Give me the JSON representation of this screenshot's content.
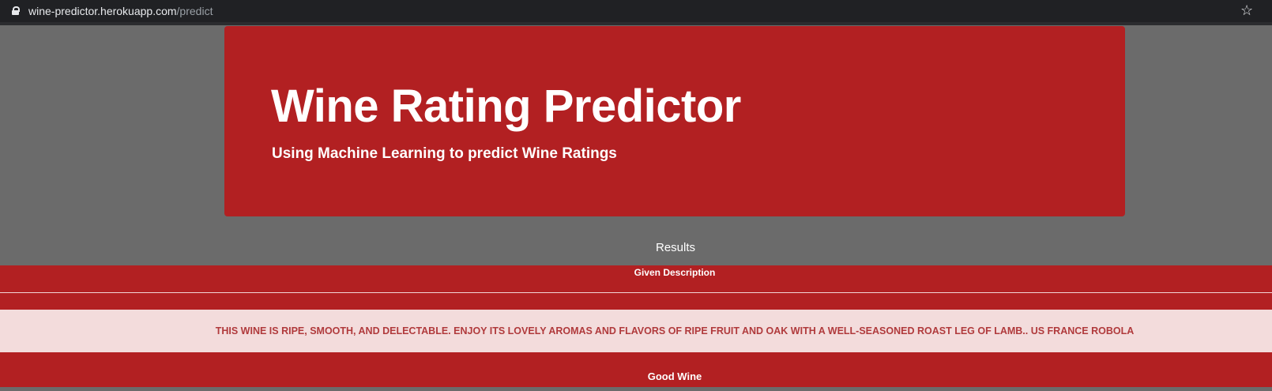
{
  "browser": {
    "url_host": "wine-predictor.herokuapp.com",
    "url_path": "/predict",
    "lock_icon": "lock-icon",
    "bookmark_icon": "star-icon"
  },
  "jumbotron": {
    "title": "Wine Rating Predictor",
    "subtitle": "Using Machine Learning to predict Wine Ratings"
  },
  "results": {
    "caption": "Results",
    "header_label": "Given Description",
    "description": "THIS WINE IS RIPE, SMOOTH, AND DELECTABLE. ENJOY ITS LOVELY AROMAS AND FLAVORS OF RIPE FRUIT AND OAK WITH A WELL-SEASONED ROAST LEG OF LAMB.. US FRANCE ROBOLA",
    "prediction": "Good Wine"
  },
  "colors": {
    "page_background": "#6b6b6b",
    "accent_red": "#b22022",
    "description_background": "#f3dcdc",
    "description_text": "#b03a3c"
  }
}
